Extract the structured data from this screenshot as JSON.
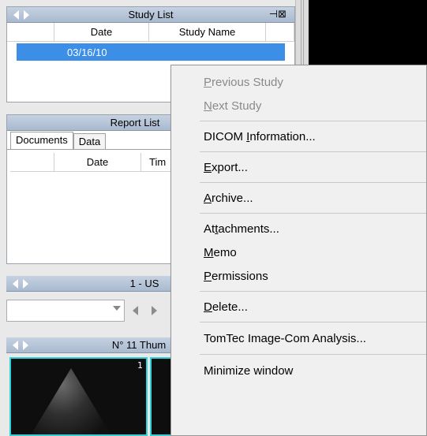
{
  "study_list": {
    "title": "Study List",
    "pin_icon": "pin-icon",
    "columns": [
      "Date",
      "Study Name"
    ],
    "selected_row": {
      "date": "03/16/10"
    }
  },
  "report_list": {
    "title": "Report List",
    "tabs": [
      "Documents",
      "Data"
    ],
    "columns": [
      "Date",
      "Tim"
    ]
  },
  "series_panel": {
    "title": "1 - US"
  },
  "thumb_panel": {
    "title": "N° 11 Thum",
    "thumb_index": "1"
  },
  "context_menu": {
    "items": [
      {
        "pre": "",
        "key": "P",
        "post": "revious Study",
        "disabled": true
      },
      {
        "pre": "",
        "key": "N",
        "post": "ext Study",
        "disabled": true
      },
      {
        "pre": "DICOM ",
        "key": "I",
        "post": "nformation...",
        "disabled": false
      },
      {
        "pre": "",
        "key": "E",
        "post": "xport...",
        "disabled": false
      },
      {
        "pre": "",
        "key": "A",
        "post": "rchive...",
        "disabled": false
      },
      {
        "pre": "At",
        "key": "t",
        "post": "achments...",
        "disabled": false
      },
      {
        "pre": "",
        "key": "M",
        "post": "emo",
        "disabled": false
      },
      {
        "pre": "",
        "key": "P",
        "post": "ermissions",
        "disabled": false
      },
      {
        "pre": "",
        "key": "D",
        "post": "elete...",
        "disabled": false
      },
      {
        "pre": "TomTec Image-Com Analysis...",
        "key": "",
        "post": "",
        "disabled": false
      },
      {
        "pre": "Minimize window",
        "key": "",
        "post": "",
        "disabled": false
      }
    ]
  },
  "colors": {
    "title_bar": "#b4c3d8",
    "selection": "#3d8ee6",
    "thumb_border": "#2fd2d8"
  }
}
